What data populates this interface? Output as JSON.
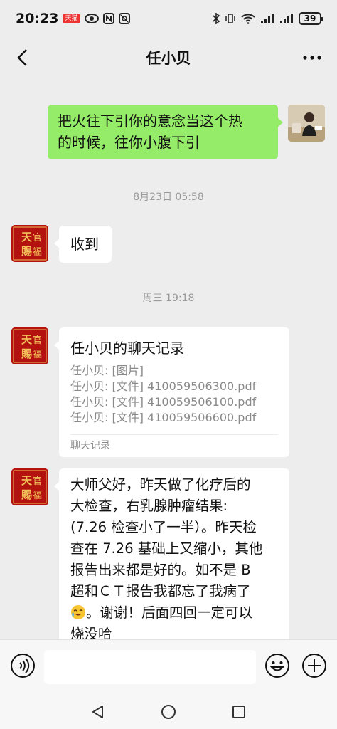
{
  "status_bar": {
    "time": "20:23",
    "tmall_badge": "天猫",
    "battery": "39"
  },
  "header": {
    "title": "任小贝"
  },
  "messages": {
    "outgoing": {
      "line1": "把火往下引你的意念当这个热",
      "line2": "的时候，往你小腹下引"
    },
    "time1": "8月23日 05:58",
    "reply1": "收到",
    "time2": "周三 19:18",
    "record": {
      "title": "任小贝的聊天记录",
      "lines": [
        "任小贝: [图片]",
        "任小贝: [文件] 410059506300.pdf",
        "任小贝: [文件] 410059506100.pdf",
        "任小贝: [文件] 410059506600.pdf"
      ],
      "footer": "聊天记录"
    },
    "long_message": {
      "lines": [
        "大师父好，昨天做了化疗后的",
        "大检查，右乳腺肿瘤结果:",
        "(7.26 检查小了一半）。昨天检",
        "查在 7.26 基础上又缩小，其他",
        "报告出来都是好的。如不是 B",
        "超和ＣＴ报告我都忘了我病了"
      ],
      "line7_after_emoji": "。谢谢！后面四回一定可以",
      "line8": "烧没哈"
    },
    "avatar_stamp_text": [
      "天",
      "官",
      "賜",
      "福"
    ]
  },
  "input": {
    "placeholder": ""
  },
  "colors": {
    "background": "#ededed",
    "outgoing_bubble": "#95ec69",
    "incoming_bubble": "#ffffff",
    "stamp_red": "#b3120f"
  },
  "icons": {
    "voice": "voice-icon",
    "emoji": "emoji-icon",
    "more": "add-icon",
    "back": "back-icon",
    "menu": "more-icon"
  }
}
